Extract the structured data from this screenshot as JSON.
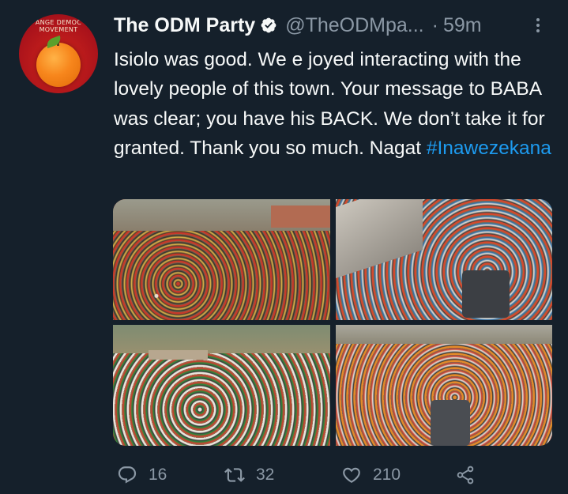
{
  "tweet": {
    "display_name": "The ODM Party",
    "handle": "@TheODMpa...",
    "separator": "·",
    "time": "59m",
    "text_main": "Isiolo was good. We e joyed interacting with the lovely people of this town. Your message to BABA was clear; you have his BACK. We don’t take it for granted. Thank you so much. Nagat ",
    "hashtag": "#Inawezekana",
    "avatar_text": "ANGE DEMOC MOVEMENT"
  },
  "actions": {
    "reply_count": "16",
    "retweet_count": "32",
    "like_count": "210"
  },
  "icons": {
    "verified": "verified-badge-icon",
    "more": "more-options-icon",
    "reply": "reply-icon",
    "retweet": "retweet-icon",
    "like": "heart-icon",
    "share": "share-icon"
  },
  "colors": {
    "background": "#15202b",
    "text": "#f7f9f9",
    "secondary": "#8b98a5",
    "link": "#1d9bf0"
  }
}
